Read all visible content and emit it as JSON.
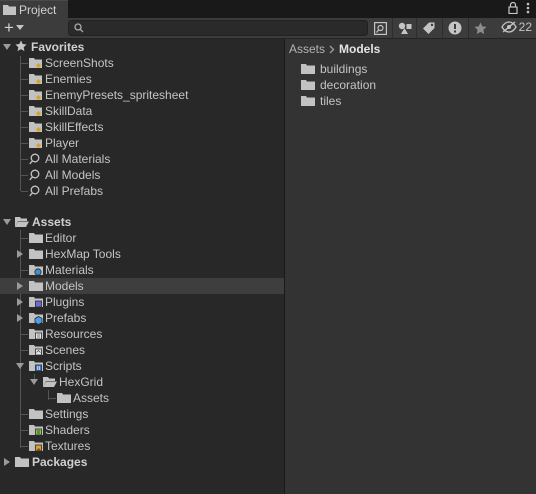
{
  "tab": {
    "title": "Project"
  },
  "toolbar": {
    "hidden_count": "22"
  },
  "favorites": {
    "header": "Favorites",
    "items": [
      {
        "label": "ScreenShots",
        "kind": "fav-folder"
      },
      {
        "label": "Enemies",
        "kind": "fav-folder"
      },
      {
        "label": "EnemyPresets_spritesheet",
        "kind": "fav-folder"
      },
      {
        "label": "SkillData",
        "kind": "fav-folder"
      },
      {
        "label": "SkillEffects",
        "kind": "fav-folder"
      },
      {
        "label": "Player",
        "kind": "fav-folder"
      },
      {
        "label": "All Materials",
        "kind": "search"
      },
      {
        "label": "All Models",
        "kind": "search"
      },
      {
        "label": "All Prefabs",
        "kind": "search"
      }
    ]
  },
  "assets": {
    "header": "Assets",
    "items": [
      {
        "label": "Editor"
      },
      {
        "label": "HexMap Tools"
      },
      {
        "label": "Materials"
      },
      {
        "label": "Models"
      },
      {
        "label": "Plugins"
      },
      {
        "label": "Prefabs"
      },
      {
        "label": "Resources"
      },
      {
        "label": "Scenes"
      },
      {
        "label": "Scripts"
      },
      {
        "label": "HexGrid"
      },
      {
        "label": "Assets"
      },
      {
        "label": "Settings"
      },
      {
        "label": "Shaders"
      },
      {
        "label": "Textures"
      }
    ]
  },
  "packages": {
    "header": "Packages"
  },
  "breadcrumb": {
    "root": "Assets",
    "current": "Models"
  },
  "contents": [
    {
      "label": "buildings"
    },
    {
      "label": "decoration"
    },
    {
      "label": "tiles"
    }
  ],
  "colors": {
    "folder": "#c2c2c2",
    "fav_star": "#d4a02a",
    "selected_row": "#3e3e3e"
  }
}
